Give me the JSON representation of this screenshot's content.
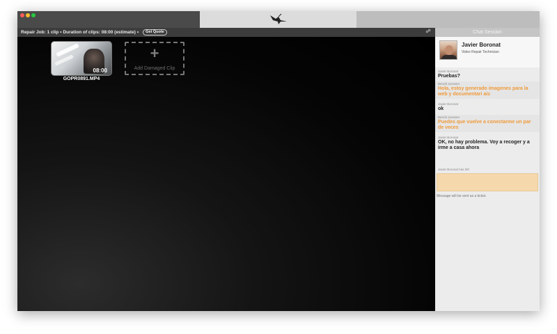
{
  "titlebar": {
    "logo_icon": "crane-bird-icon"
  },
  "jobbar": {
    "repair_job": "Repair Job: 1 clip",
    "separator": "•",
    "duration": "Duration of clips: 08:00 (estimate)",
    "separator2": "•",
    "quote_button": "Get Quote",
    "link_icon": "link-icon"
  },
  "clip": {
    "duration": "08:00",
    "filename": "GOPR0891.MP4"
  },
  "add_clip": {
    "plus": "+",
    "label": "Add Damaged Clip"
  },
  "chat": {
    "header": "Chat Session",
    "technician": {
      "name": "Javier Boronat",
      "role": "Video Repair Technician"
    },
    "messages": [
      {
        "author": "Javier Boronat",
        "text": "Pruebas?"
      },
      {
        "author": "Benoît Joossen",
        "text": "Hola, estoy generado imagenes para la web y documentari ais"
      },
      {
        "author": "Javier Boronat",
        "text": "ok"
      },
      {
        "author": "Benoît Joossen",
        "text": "Puedes que vuelve a conectarme un par de veces"
      },
      {
        "author": "Javier Boronat",
        "text": "OK, no hay problema. Voy a recoger y a irme a casa ahora"
      }
    ],
    "typing": "Javier Boronat has left",
    "input_value": "",
    "note": "Message will be sent as a ticket."
  },
  "colors": {
    "orange_text": "#f09a3a",
    "input_bg": "#f5d9ad"
  }
}
